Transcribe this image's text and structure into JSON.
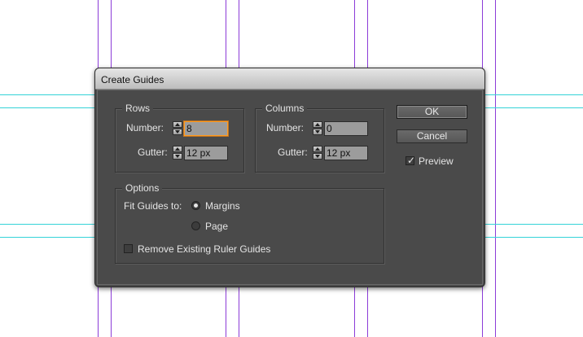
{
  "dialog": {
    "title": "Create Guides",
    "rows": {
      "legend": "Rows",
      "number_label": "Number:",
      "number_value": "8",
      "gutter_label": "Gutter:",
      "gutter_value": "12 px"
    },
    "columns": {
      "legend": "Columns",
      "number_label": "Number:",
      "number_value": "0",
      "gutter_label": "Gutter:",
      "gutter_value": "12 px"
    },
    "options": {
      "legend": "Options",
      "fit_label": "Fit Guides to:",
      "fit_choices": [
        {
          "label": "Margins",
          "selected": true
        },
        {
          "label": "Page",
          "selected": false
        }
      ],
      "remove_guides_label": "Remove Existing Ruler Guides",
      "remove_guides_checked": false
    },
    "buttons": {
      "ok": "OK",
      "cancel": "Cancel"
    },
    "preview": {
      "label": "Preview",
      "checked": true
    }
  },
  "colors": {
    "column_guide": "#8c3cd8",
    "row_guide": "#34d3d8",
    "focus_ring": "#ff9b1f"
  }
}
